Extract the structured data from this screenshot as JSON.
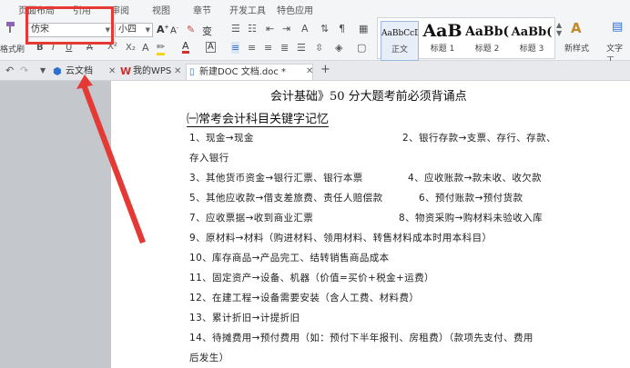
{
  "menubar": {
    "items": [
      "页面布局",
      "引用",
      "审阅",
      "视图",
      "章节",
      "开发工具",
      "特色应用"
    ]
  },
  "ribbon": {
    "format_painter_label": "格式刷",
    "font_name": "仿宋",
    "font_size": "小四",
    "styles": [
      {
        "preview": "AaBbCcD",
        "name": "正文"
      },
      {
        "preview": "AaB",
        "name": "标题 1"
      },
      {
        "preview": "AaBb(",
        "name": "标题 2"
      },
      {
        "preview": "AaBb(",
        "name": "标题 3"
      }
    ],
    "new_style_label": "新样式",
    "text_tools_label": "文字工"
  },
  "tabbar": {
    "tabs": [
      {
        "label": "云文档"
      },
      {
        "label": "我的WPS"
      },
      {
        "label": "新建DOC 文档.doc *"
      }
    ],
    "add_tab_label": "+"
  },
  "document": {
    "title": "会计基础》50 分大题考前必须背诵点",
    "subtitle": "㈠常考会计科目关键字记忆",
    "lines": [
      "1、现金→现金",
      "2、银行存款→支票、存行、存款、",
      "存入银行",
      "3、其他货币资金→银行汇票、银行本票",
      "4、应收账款→款未收、收欠款",
      "5、其他应收款→借支差旅费、责任人赔偿款",
      "6、预付账款→预付货款",
      "7、应收票据→收到商业汇票",
      "8、物资采购→购材料未验收入库",
      "9、原材料→材料（购进材料、领用材料、转售材料成本时用本科目）",
      "10、库存商品→产品完工、结转销售商品成本",
      "11、固定资产→设备、机器（价值=买价+税金+运费）",
      "12、在建工程→设备需要安装（含人工费、材料费）",
      "13、累计折旧→计提折旧",
      "14、待摊费用→预付费用（如：预付下半年报刊、房租费）（款项先支付、费用",
      "后发生）"
    ]
  },
  "colors": {
    "highlight": "#e53935",
    "accent": "#2e6fd1"
  }
}
